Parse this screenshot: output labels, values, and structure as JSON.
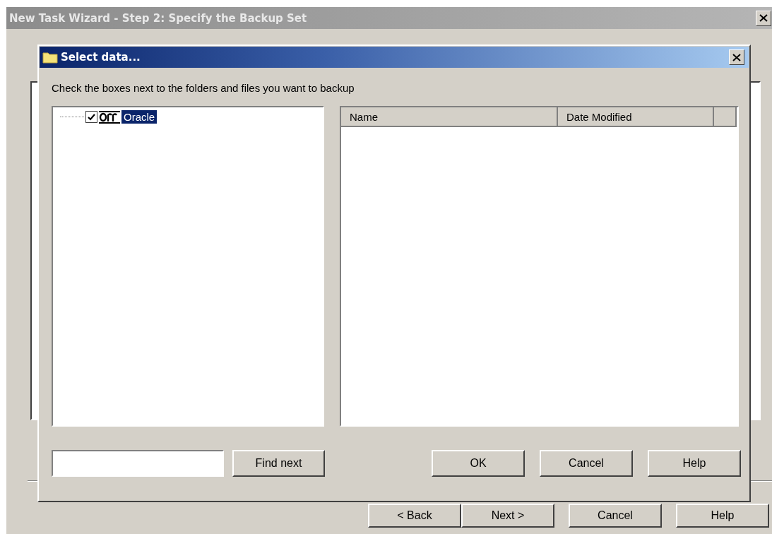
{
  "window": {
    "title": "New Task Wizard - Step 2: Specify the Backup Set",
    "buttons": [
      {
        "label": "< Back",
        "kind": "back"
      },
      {
        "label": "Next >",
        "kind": "next"
      },
      {
        "label": "Cancel",
        "kind": "plain"
      },
      {
        "label": "Help",
        "kind": "plain"
      }
    ]
  },
  "dialog": {
    "title": "Select data...",
    "instruction": "Check the boxes next to the folders and files you want to backup",
    "tree": [
      {
        "label": "Oracle",
        "checked": true,
        "selected": true
      }
    ],
    "columns": [
      "Name",
      "Date Modified"
    ],
    "find_button": "Find next",
    "buttons": [
      "OK",
      "Cancel",
      "Help"
    ]
  }
}
